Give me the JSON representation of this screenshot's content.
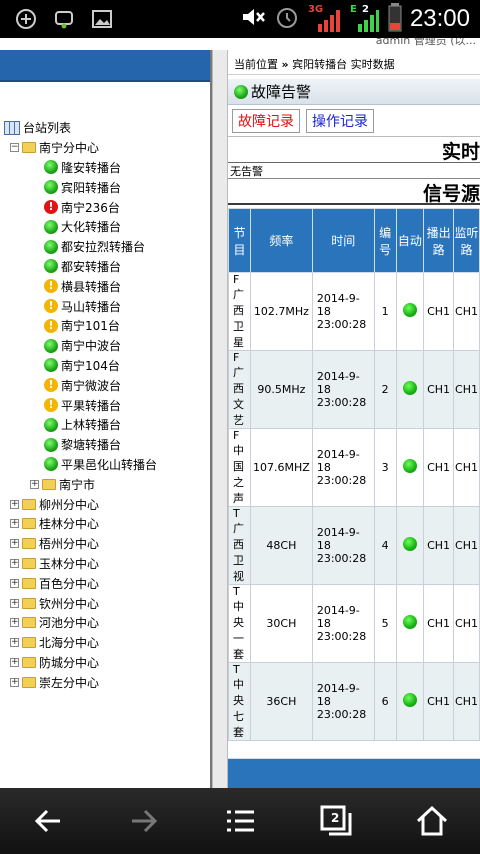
{
  "status_bar": {
    "time": "23:00",
    "network_3g": "3G",
    "network_e": "E",
    "network_2": "2",
    "icons": [
      "add-circle-icon",
      "chat-icon",
      "gallery-icon",
      "mute-icon",
      "alarm-icon",
      "signal-icon",
      "battery-icon"
    ]
  },
  "top_strip_text": "admin 管理员 (以...",
  "left_pane": {
    "root_label": "台站列表",
    "nanning_center": "南宁分中心",
    "stations": [
      {
        "label": "隆安转播台",
        "status": "green"
      },
      {
        "label": "宾阳转播台",
        "status": "green"
      },
      {
        "label": "南宁236台",
        "status": "red"
      },
      {
        "label": "大化转播台",
        "status": "green"
      },
      {
        "label": "都安拉烈转播台",
        "status": "green"
      },
      {
        "label": "都安转播台",
        "status": "green"
      },
      {
        "label": "横县转播台",
        "status": "yellow"
      },
      {
        "label": "马山转播台",
        "status": "yellow"
      },
      {
        "label": "南宁101台",
        "status": "yellow"
      },
      {
        "label": "南宁中波台",
        "status": "green"
      },
      {
        "label": "南宁104台",
        "status": "green"
      },
      {
        "label": "南宁微波台",
        "status": "yellow"
      },
      {
        "label": "平果转播台",
        "status": "yellow"
      },
      {
        "label": "上林转播台",
        "status": "green"
      },
      {
        "label": "黎塘转播台",
        "status": "green"
      },
      {
        "label": "平果邑化山转播台",
        "status": "green"
      }
    ],
    "nanning_city": "南宁市",
    "other_centers": [
      "柳州分中心",
      "桂林分中心",
      "梧州分中心",
      "玉林分中心",
      "百色分中心",
      "钦州分中心",
      "河池分中心",
      "北海分中心",
      "防城分中心",
      "崇左分中心"
    ]
  },
  "right_pane": {
    "breadcrumb_prefix": "当前位置",
    "breadcrumb_sep": "»",
    "breadcrumb_path": "宾阳转播台 实时数据",
    "alarm_title": "故障告警",
    "tab_fault": "故障记录",
    "tab_ops": "操作记录",
    "realtime_title": "实时",
    "no_alarm": "无告警",
    "signal_title": "信号源",
    "table": {
      "headers": [
        "节目",
        "频率",
        "时间",
        "编号",
        "自动",
        "播出路",
        "监听路"
      ],
      "rows": [
        {
          "program": "F广西卫星",
          "freq": "102.7MHz",
          "time": "2014-9-18 23:00:28",
          "no": "1",
          "auto": "on",
          "out": "CH1",
          "mon": "CH1"
        },
        {
          "program": "F广西文艺",
          "freq": "90.5MHz",
          "time": "2014-9-18 23:00:28",
          "no": "2",
          "auto": "on",
          "out": "CH1",
          "mon": "CH1"
        },
        {
          "program": "F中国之声",
          "freq": "107.6MHZ",
          "time": "2014-9-18 23:00:28",
          "no": "3",
          "auto": "on",
          "out": "CH1",
          "mon": "CH1"
        },
        {
          "program": "T广西卫视",
          "freq": "48CH",
          "time": "2014-9-18 23:00:28",
          "no": "4",
          "auto": "on",
          "out": "CH1",
          "mon": "CH1"
        },
        {
          "program": "T中央一套",
          "freq": "30CH",
          "time": "2014-9-18 23:00:28",
          "no": "5",
          "auto": "on",
          "out": "CH1",
          "mon": "CH1"
        },
        {
          "program": "T中央七套",
          "freq": "36CH",
          "time": "2014-9-18 23:00:28",
          "no": "6",
          "auto": "on",
          "out": "CH1",
          "mon": "CH1"
        }
      ]
    }
  },
  "nav_bar": {
    "tab_count": "2",
    "icons": [
      "back-arrow-icon",
      "forward-arrow-icon",
      "menu-icon",
      "tabs-icon",
      "home-icon"
    ]
  }
}
